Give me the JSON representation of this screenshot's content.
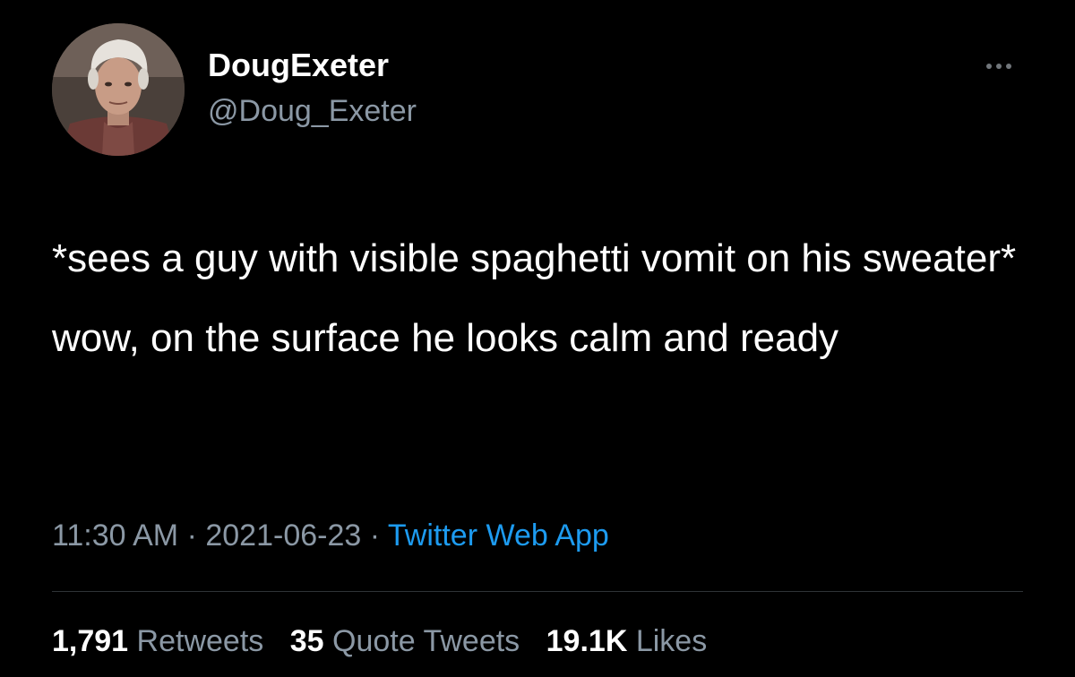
{
  "author": {
    "display_name": "DougExeter",
    "handle": "@Doug_Exeter",
    "avatar_icon": "profile-photo"
  },
  "menu": {
    "icon": "more-options-icon"
  },
  "tweet": {
    "text": "*sees a guy with visible spaghetti vomit on his sweater* wow, on the surface he looks calm and ready",
    "time": "11:30 AM",
    "separator": " · ",
    "date": "2021-06-23",
    "source": "Twitter Web App"
  },
  "stats": {
    "retweets": {
      "count": "1,791",
      "label": "Retweets"
    },
    "quote_tweets": {
      "count": "35",
      "label": "Quote Tweets"
    },
    "likes": {
      "count": "19.1K",
      "label": "Likes"
    }
  },
  "colors": {
    "background": "#000000",
    "text": "#ffffff",
    "secondary": "#8b98a5",
    "link": "#1d9bf0",
    "divider": "#2f3336"
  }
}
